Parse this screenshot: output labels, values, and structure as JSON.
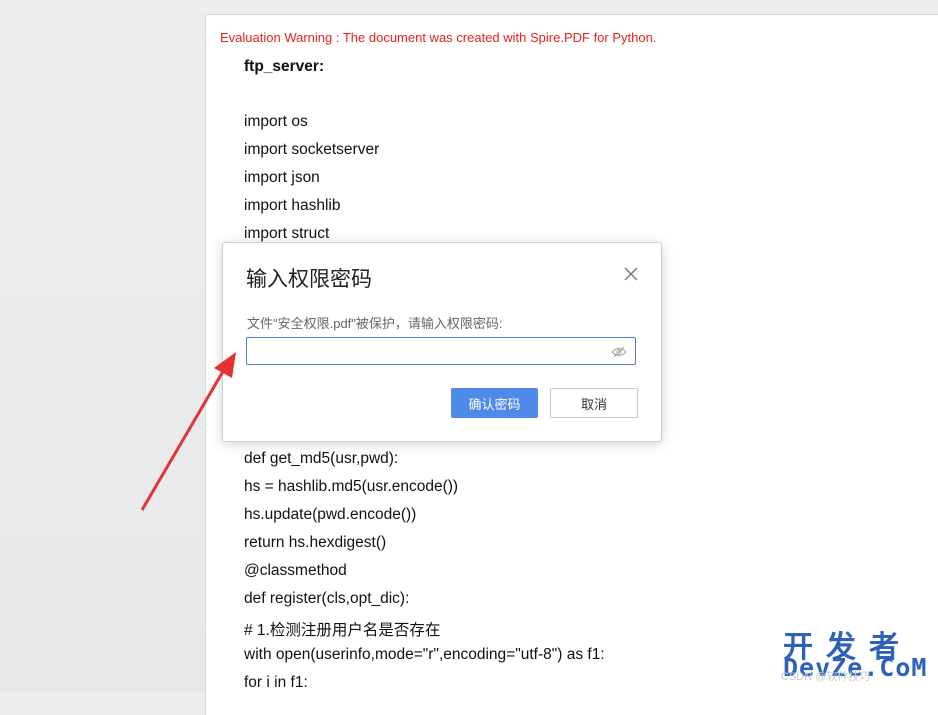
{
  "document": {
    "evaluation_warning": "Evaluation Warning : The document was created with Spire.PDF for Python.",
    "heading": "ftp_server:",
    "lines_top": [
      "import os",
      "import socketserver",
      "import json",
      "import hashlib",
      "import struct"
    ],
    "lines_bottom": [
      "def get_md5(usr,pwd):",
      "hs = hashlib.md5(usr.encode())",
      "hs.update(pwd.encode())",
      "return hs.hexdigest()",
      "@classmethod",
      "def register(cls,opt_dic):",
      "# 1.检测注册用户名是否存在",
      "with open(userinfo,mode=\"r\",encoding=\"utf-8\") as f1:",
      "for i in f1:"
    ]
  },
  "dialog": {
    "title": "输入权限密码",
    "prompt": "文件\"安全权限.pdf\"被保护，请输入权限密码:",
    "password_value": "",
    "confirm_label": "确认密码",
    "cancel_label": "取消"
  },
  "watermark": {
    "cn": "开发者",
    "en": "DevZe.CoM",
    "sub": "CSDN @软件技巧"
  },
  "colors": {
    "warning": "#e6231a",
    "primary_button": "#4f8ae8",
    "input_border": "#4a7fd6",
    "arrow": "#e53333",
    "watermark": "#2d62b8"
  }
}
